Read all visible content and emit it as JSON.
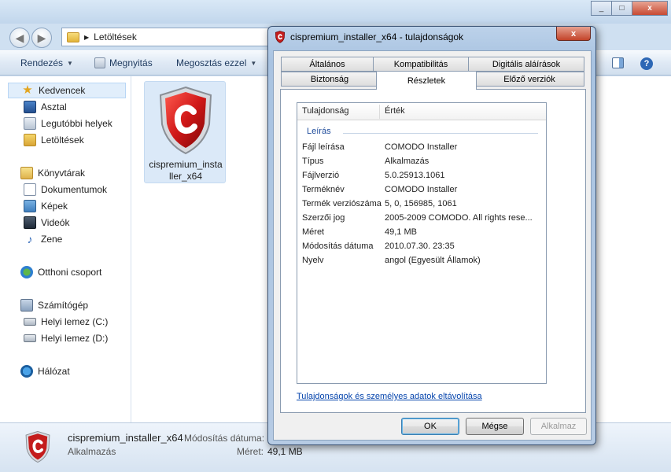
{
  "explorer": {
    "address": "Letöltések",
    "toolbar": {
      "organize": "Rendezés",
      "open": "Megnyitás",
      "share": "Megosztás ezzel"
    },
    "nav": {
      "favorites": "Kedvencek",
      "desktop": "Asztal",
      "recent": "Legutóbbi helyek",
      "downloads": "Letöltések",
      "libraries": "Könyvtárak",
      "documents": "Dokumentumok",
      "pictures": "Képek",
      "videos": "Videók",
      "music": "Zene",
      "homegroup": "Otthoni csoport",
      "computer": "Számítógép",
      "drive_c": "Helyi lemez (C:)",
      "drive_d": "Helyi lemez (D:)",
      "network": "Hálózat"
    },
    "file": {
      "name": "cispremium_installer_x64"
    },
    "details": {
      "name": "cispremium_installer_x64",
      "type": "Alkalmazás",
      "modified_label": "Módosítás dátuma:",
      "size_label": "Méret:",
      "size_value": "49,1 MB"
    }
  },
  "dialog": {
    "title": "cispremium_installer_x64 - tulajdonságok",
    "close": "x",
    "tabs_row1": [
      "Általános",
      "Kompatibilitás",
      "Digitális aláírások"
    ],
    "tabs_row2": [
      "Biztonság",
      "Részletek",
      "Előző verziók"
    ],
    "active_tab": "Részletek",
    "grid": {
      "col_property": "Tulajdonság",
      "col_value": "Érték",
      "section": "Leírás",
      "rows": [
        {
          "k": "Fájl leírása",
          "v": "COMODO Installer"
        },
        {
          "k": "Típus",
          "v": "Alkalmazás"
        },
        {
          "k": "Fájlverzió",
          "v": "5.0.25913.1061"
        },
        {
          "k": "Terméknév",
          "v": "COMODO Installer"
        },
        {
          "k": "Termék verziószáma",
          "v": "5, 0, 156985, 1061"
        },
        {
          "k": "Szerzői jog",
          "v": "2005-2009 COMODO. All rights rese..."
        },
        {
          "k": "Méret",
          "v": "49,1 MB"
        },
        {
          "k": "Módosítás dátuma",
          "v": "2010.07.30. 23:35"
        },
        {
          "k": "Nyelv",
          "v": "angol (Egyesült Államok)"
        }
      ]
    },
    "link": "Tulajdonságok és személyes adatok eltávolítása",
    "buttons": {
      "ok": "OK",
      "cancel": "Mégse",
      "apply": "Alkalmaz"
    }
  },
  "colors": {
    "accent": "#1e4b9b",
    "link": "#0645ad",
    "comodo_red": "#c41c1c"
  }
}
